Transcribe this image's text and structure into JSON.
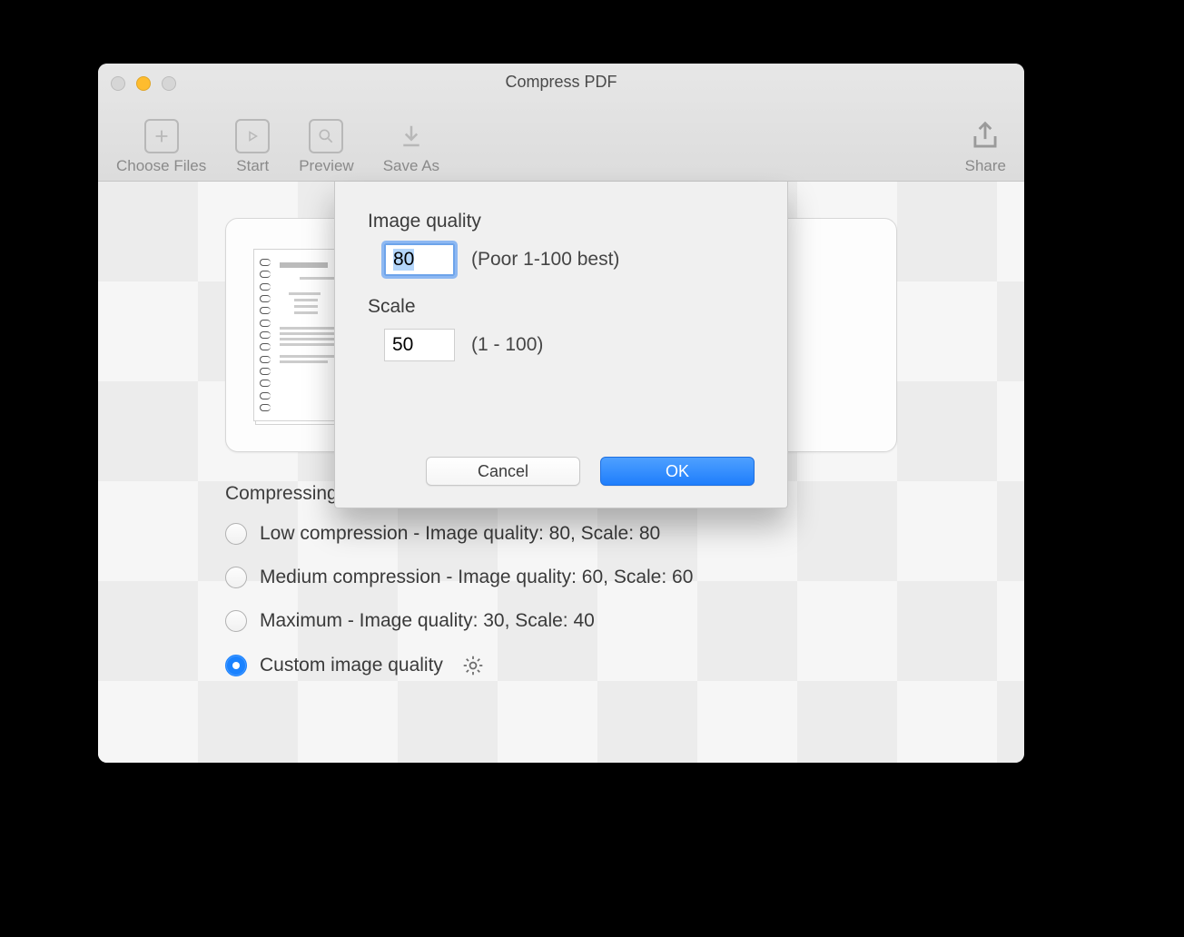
{
  "window": {
    "title": "Compress PDF"
  },
  "toolbar": {
    "choose_files": "Choose Files",
    "start": "Start",
    "preview": "Preview",
    "save_as": "Save As",
    "share": "Share"
  },
  "section_title": "Compressing option",
  "options": [
    "Low compression - Image quality: 80, Scale: 80",
    "Medium compression - Image quality: 60, Scale: 60",
    "Maximum - Image quality: 30, Scale: 40",
    "Custom image quality"
  ],
  "modal": {
    "image_quality_label": "Image quality",
    "image_quality_value": "80",
    "image_quality_hint": "(Poor 1-100 best)",
    "scale_label": "Scale",
    "scale_value": "50",
    "scale_hint": "(1 - 100)",
    "cancel": "Cancel",
    "ok": "OK"
  }
}
